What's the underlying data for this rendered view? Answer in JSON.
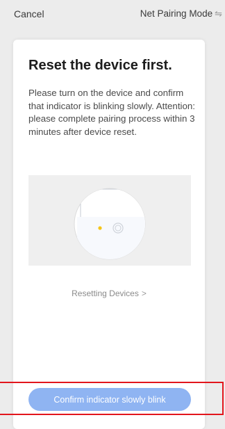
{
  "header": {
    "cancel_label": "Cancel",
    "mode_label": "Net Pairing Mode",
    "mode_icon": "⇋"
  },
  "card": {
    "title": "Reset the device first.",
    "description": "Please turn on the device and confirm that indicator is blinking slowly. Attention: please complete pairing process within 3 minutes after device reset.",
    "illustration_icon": "device-reset-illustration"
  },
  "help": {
    "link_label": "Resetting Devices",
    "chevron": ">"
  },
  "actions": {
    "confirm_label": "Confirm indicator slowly blink"
  },
  "colors": {
    "confirm_button": "#8fb4f2",
    "indicator_dot": "#f5c518",
    "highlight": "#e2151c"
  }
}
